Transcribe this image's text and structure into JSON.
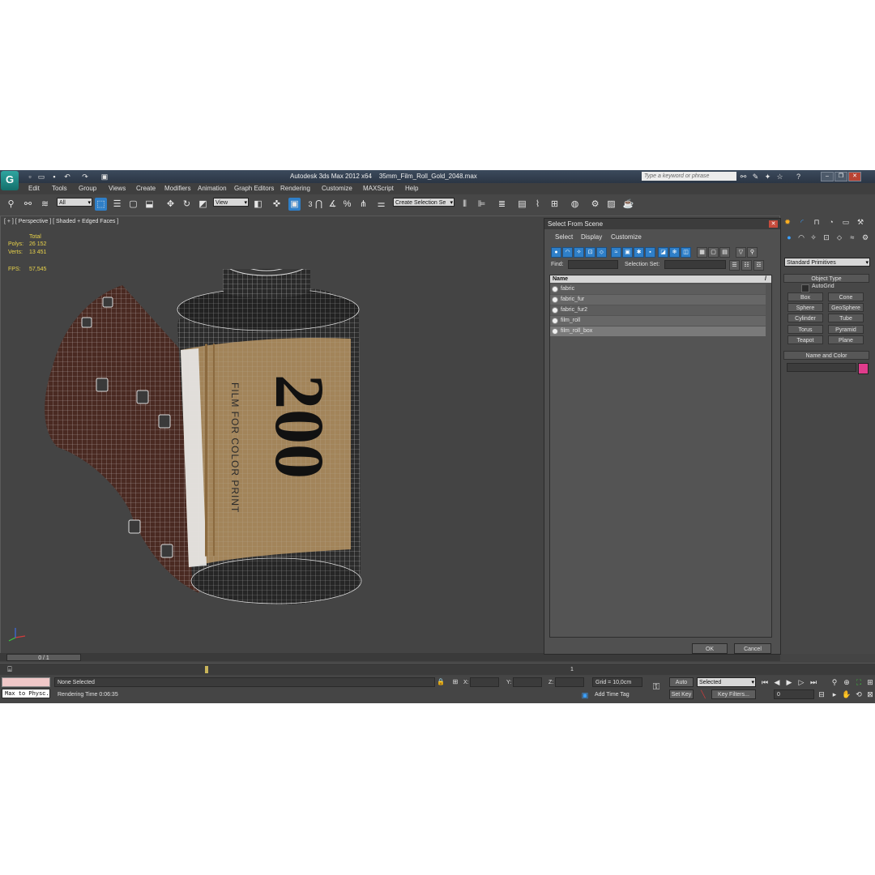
{
  "app": {
    "title": "Autodesk 3ds Max  2012 x64",
    "filename": "35mm_Film_Roll_Gold_2048.max",
    "logo": "G",
    "search_placeholder": "Type a keyword or phrase"
  },
  "menu": [
    "Edit",
    "Tools",
    "Group",
    "Views",
    "Create",
    "Modifiers",
    "Animation",
    "Graph Editors",
    "Rendering",
    "Customize",
    "MAXScript",
    "Help"
  ],
  "toolbar": {
    "filter": "All",
    "ref_coord": "View",
    "selection_set": "Create Selection Se",
    "snap_value": "3"
  },
  "viewport": {
    "label": "[ + ] [ Perspective ] [ Shaded + Edged Faces ]",
    "stats": {
      "total_label": "Total",
      "polys_label": "Polys:",
      "polys": "26 152",
      "verts_label": "Verts:",
      "verts": "13 451",
      "fps_label": "FPS:",
      "fps": "57,545"
    },
    "label_tiny": "FILM FOR COLOR PRINT",
    "label_big": "200",
    "frame": "0 / 1"
  },
  "dialog": {
    "title": "Select From Scene",
    "menus": [
      "Select",
      "Display",
      "Customize"
    ],
    "find_label": "Find:",
    "selection_set_label": "Selection Set:",
    "column": "Name",
    "sort_marker": "/",
    "items": [
      "fabric",
      "fabric_fur",
      "fabric_fur2",
      "film_roll",
      "film_roll_box"
    ],
    "ok": "OK",
    "cancel": "Cancel"
  },
  "command_panel": {
    "category": "Standard Primitives",
    "object_type": "Object Type",
    "autogrid": "AutoGrid",
    "buttons": [
      "Box",
      "Cone",
      "Sphere",
      "GeoSphere",
      "Cylinder",
      "Tube",
      "Torus",
      "Pyramid",
      "Teapot",
      "Plane"
    ],
    "name_and_color": "Name and Color",
    "swatch_color": "#e03c8c"
  },
  "status": {
    "script_listener": "Max to Physc.",
    "selection": "None Selected",
    "prompt": "Rendering Time  0:06:35",
    "x_label": "X:",
    "y_label": "Y:",
    "z_label": "Z:",
    "grid": "Grid = 10,0cm",
    "add_time_tag": "Add Time Tag",
    "auto_key": "Auto Key",
    "set_key": "Set Key",
    "key_mode": "Selected",
    "key_filters": "Key Filters...",
    "current_frame": "0",
    "track_tick": "1"
  }
}
